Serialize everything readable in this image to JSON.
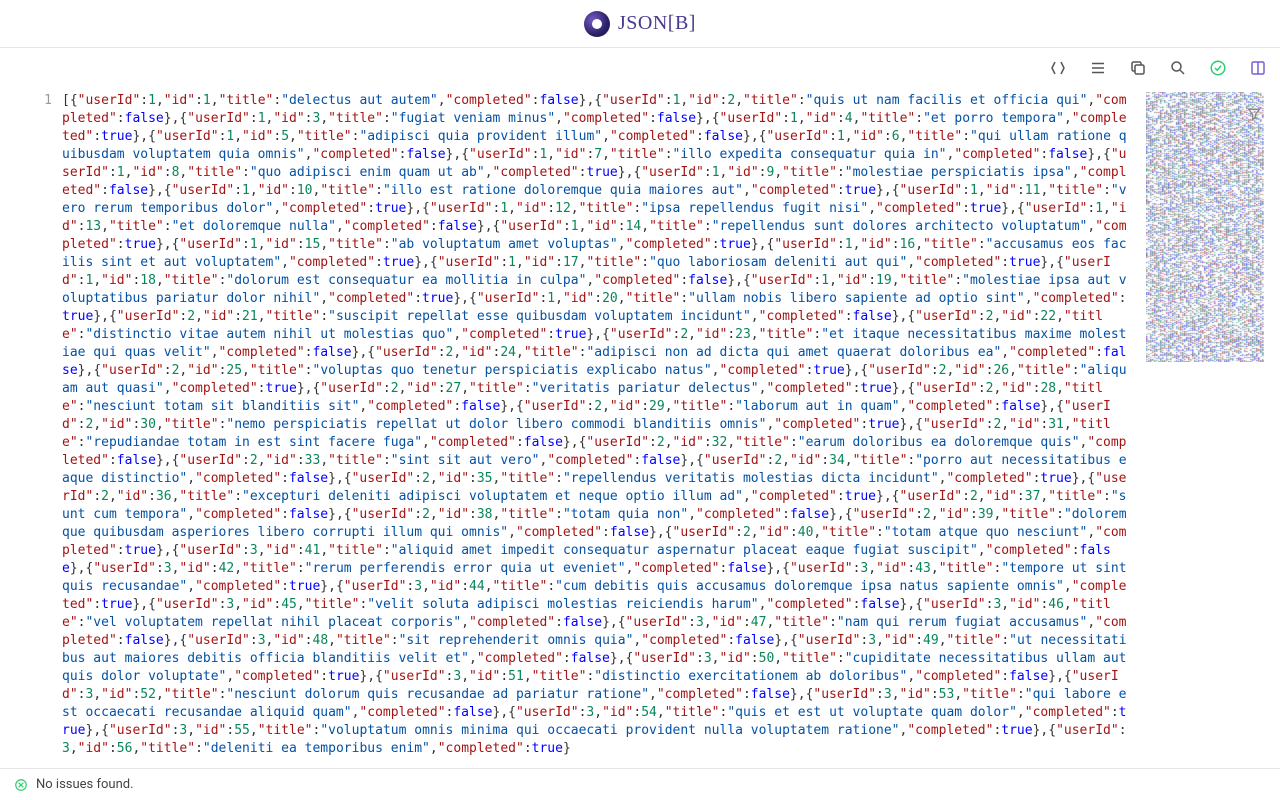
{
  "brand": {
    "name": "JSON[B]"
  },
  "toolbar": {
    "format_icon": "format",
    "list_icon": "list",
    "copy_icon": "copy",
    "search_icon": "search",
    "validate_icon": "validate",
    "split_icon": "split"
  },
  "editor": {
    "line_number": "1"
  },
  "status": {
    "text": "No issues found."
  },
  "colors": {
    "key": "#a31515",
    "string": "#0451a5",
    "number": "#098658",
    "boolean": "#0000ff"
  },
  "chart_data": {
    "type": "table",
    "title": "JSON array of todo items",
    "columns": [
      "userId",
      "id",
      "title",
      "completed"
    ],
    "rows": [
      {
        "userId": 1,
        "id": 1,
        "title": "delectus aut autem",
        "completed": false
      },
      {
        "userId": 1,
        "id": 2,
        "title": "quis ut nam facilis et officia qui",
        "completed": false
      },
      {
        "userId": 1,
        "id": 3,
        "title": "fugiat veniam minus",
        "completed": false
      },
      {
        "userId": 1,
        "id": 4,
        "title": "et porro tempora",
        "completed": true
      },
      {
        "userId": 1,
        "id": 5,
        "title": "adipisci quia provident illum",
        "completed": false
      },
      {
        "userId": 1,
        "id": 6,
        "title": "qui ullam ratione quibusdam voluptatem quia omnis",
        "completed": false
      },
      {
        "userId": 1,
        "id": 7,
        "title": "illo expedita consequatur quia in",
        "completed": false
      },
      {
        "userId": 1,
        "id": 8,
        "title": "quo adipisci enim quam ut ab",
        "completed": true
      },
      {
        "userId": 1,
        "id": 9,
        "title": "molestiae perspiciatis ipsa",
        "completed": false
      },
      {
        "userId": 1,
        "id": 10,
        "title": "illo est ratione doloremque quia maiores aut",
        "completed": true
      },
      {
        "userId": 1,
        "id": 11,
        "title": "vero rerum temporibus dolor",
        "completed": true
      },
      {
        "userId": 1,
        "id": 12,
        "title": "ipsa repellendus fugit nisi",
        "completed": true
      },
      {
        "userId": 1,
        "id": 13,
        "title": "et doloremque nulla",
        "completed": false
      },
      {
        "userId": 1,
        "id": 14,
        "title": "repellendus sunt dolores architecto voluptatum",
        "completed": true
      },
      {
        "userId": 1,
        "id": 15,
        "title": "ab voluptatum amet voluptas",
        "completed": true
      },
      {
        "userId": 1,
        "id": 16,
        "title": "accusamus eos facilis sint et aut voluptatem",
        "completed": true
      },
      {
        "userId": 1,
        "id": 17,
        "title": "quo laboriosam deleniti aut qui",
        "completed": true
      },
      {
        "userId": 1,
        "id": 18,
        "title": "dolorum est consequatur ea mollitia in culpa",
        "completed": false
      },
      {
        "userId": 1,
        "id": 19,
        "title": "molestiae ipsa aut voluptatibus pariatur dolor nihil",
        "completed": true
      },
      {
        "userId": 1,
        "id": 20,
        "title": "ullam nobis libero sapiente ad optio sint",
        "completed": true
      },
      {
        "userId": 2,
        "id": 21,
        "title": "suscipit repellat esse quibusdam voluptatem incidunt",
        "completed": false
      },
      {
        "userId": 2,
        "id": 22,
        "title": "distinctio vitae autem nihil ut molestias quo",
        "completed": true
      },
      {
        "userId": 2,
        "id": 23,
        "title": "et itaque necessitatibus maxime molestiae qui quas velit",
        "completed": false
      },
      {
        "userId": 2,
        "id": 24,
        "title": "adipisci non ad dicta qui amet quaerat doloribus ea",
        "completed": false
      },
      {
        "userId": 2,
        "id": 25,
        "title": "voluptas quo tenetur perspiciatis explicabo natus",
        "completed": true
      },
      {
        "userId": 2,
        "id": 26,
        "title": "aliquam aut quasi",
        "completed": true
      },
      {
        "userId": 2,
        "id": 27,
        "title": "veritatis pariatur delectus",
        "completed": true
      },
      {
        "userId": 2,
        "id": 28,
        "title": "nesciunt totam sit blanditiis sit",
        "completed": false
      },
      {
        "userId": 2,
        "id": 29,
        "title": "laborum aut in quam",
        "completed": false
      },
      {
        "userId": 2,
        "id": 30,
        "title": "nemo perspiciatis repellat ut dolor libero commodi blanditiis omnis",
        "completed": true
      },
      {
        "userId": 2,
        "id": 31,
        "title": "repudiandae totam in est sint facere fuga",
        "completed": false
      },
      {
        "userId": 2,
        "id": 32,
        "title": "earum doloribus ea doloremque quis",
        "completed": false
      },
      {
        "userId": 2,
        "id": 33,
        "title": "sint sit aut vero",
        "completed": false
      },
      {
        "userId": 2,
        "id": 34,
        "title": "porro aut necessitatibus eaque distinctio",
        "completed": false
      },
      {
        "userId": 2,
        "id": 35,
        "title": "repellendus veritatis molestias dicta incidunt",
        "completed": true
      },
      {
        "userId": 2,
        "id": 36,
        "title": "excepturi deleniti adipisci voluptatem et neque optio illum ad",
        "completed": true
      },
      {
        "userId": 2,
        "id": 37,
        "title": "sunt cum tempora",
        "completed": false
      },
      {
        "userId": 2,
        "id": 38,
        "title": "totam quia non",
        "completed": false
      },
      {
        "userId": 2,
        "id": 39,
        "title": "doloremque quibusdam asperiores libero corrupti illum qui omnis",
        "completed": false
      },
      {
        "userId": 2,
        "id": 40,
        "title": "totam atque quo nesciunt",
        "completed": true
      },
      {
        "userId": 3,
        "id": 41,
        "title": "aliquid amet impedit consequatur aspernatur placeat eaque fugiat suscipit",
        "completed": false
      },
      {
        "userId": 3,
        "id": 42,
        "title": "rerum perferendis error quia ut eveniet",
        "completed": false
      },
      {
        "userId": 3,
        "id": 43,
        "title": "tempore ut sint quis recusandae",
        "completed": true
      },
      {
        "userId": 3,
        "id": 44,
        "title": "cum debitis quis accusamus doloremque ipsa natus sapiente omnis",
        "completed": true
      },
      {
        "userId": 3,
        "id": 45,
        "title": "velit soluta adipisci molestias reiciendis harum",
        "completed": false
      },
      {
        "userId": 3,
        "id": 46,
        "title": "vel voluptatem repellat nihil placeat corporis",
        "completed": false
      },
      {
        "userId": 3,
        "id": 47,
        "title": "nam qui rerum fugiat accusamus",
        "completed": false
      },
      {
        "userId": 3,
        "id": 48,
        "title": "sit reprehenderit omnis quia",
        "completed": false
      },
      {
        "userId": 3,
        "id": 49,
        "title": "ut necessitatibus aut maiores debitis officia blanditiis velit et",
        "completed": false
      },
      {
        "userId": 3,
        "id": 50,
        "title": "cupiditate necessitatibus ullam aut quis dolor voluptate",
        "completed": true
      },
      {
        "userId": 3,
        "id": 51,
        "title": "distinctio exercitationem ab doloribus",
        "completed": false
      },
      {
        "userId": 3,
        "id": 52,
        "title": "nesciunt dolorum quis recusandae ad pariatur ratione",
        "completed": false
      },
      {
        "userId": 3,
        "id": 53,
        "title": "qui labore est occaecati recusandae aliquid quam",
        "completed": false
      },
      {
        "userId": 3,
        "id": 54,
        "title": "quis et est ut voluptate quam dolor",
        "completed": true
      },
      {
        "userId": 3,
        "id": 55,
        "title": "voluptatum omnis minima qui occaecati provident nulla voluptatem ratione",
        "completed": true
      },
      {
        "userId": 3,
        "id": 56,
        "title": "deleniti ea temporibus enim",
        "completed": true
      }
    ]
  }
}
